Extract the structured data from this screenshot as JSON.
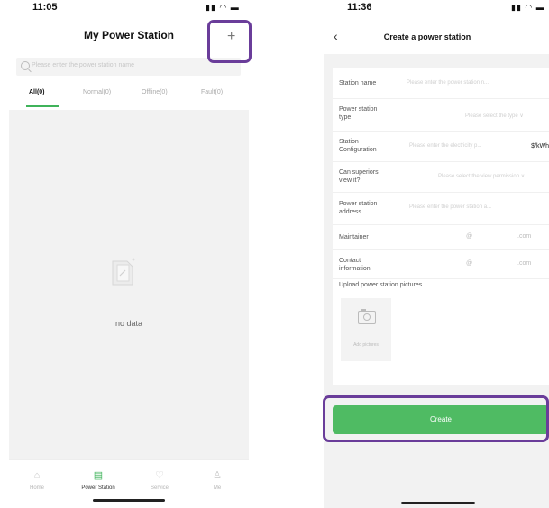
{
  "left_phone": {
    "status_time": "11:05",
    "title": "My Power Station",
    "add_button": "+",
    "search_placeholder": "Please enter the power station name",
    "tabs": [
      {
        "label": "All(0)",
        "active": true
      },
      {
        "label": "Normal(0)",
        "active": false
      },
      {
        "label": "Offline(0)",
        "active": false
      },
      {
        "label": "Fault(0)",
        "active": false
      }
    ],
    "empty_text": "no data",
    "tabbar": [
      {
        "label": "Home",
        "icon": "home-icon",
        "active": false
      },
      {
        "label": "Power Station",
        "icon": "power-station-icon",
        "active": true
      },
      {
        "label": "Service",
        "icon": "service-icon",
        "active": false
      },
      {
        "label": "Me",
        "icon": "user-icon",
        "active": false
      }
    ]
  },
  "right_phone": {
    "status_time": "11:36",
    "back_icon": "chevron-left-icon",
    "title": "Create a power station",
    "fields": [
      {
        "label": "Station name",
        "placeholder": "Please enter the power station n..."
      },
      {
        "label": "Power station type",
        "placeholder": "Please select the type ∨"
      },
      {
        "label": "Station Configuration",
        "placeholder": "Please enter the electricity p...",
        "unit": "$/kWh"
      },
      {
        "label": "Can superiors view it?",
        "placeholder": "Please select the view permission ∨"
      },
      {
        "label": "Power station address",
        "placeholder": "Please enter the power station a..."
      },
      {
        "label": "Maintainer",
        "at": "@",
        "suffix": ".com"
      },
      {
        "label": "Contact information",
        "at": "@",
        "suffix": ".com"
      }
    ],
    "upload_label": "Upload power station pictures",
    "add_pictures_label": "Add pictures",
    "create_button": "Create"
  },
  "colors": {
    "accent": "#4fbb63",
    "highlight": "#6a3d9a"
  }
}
